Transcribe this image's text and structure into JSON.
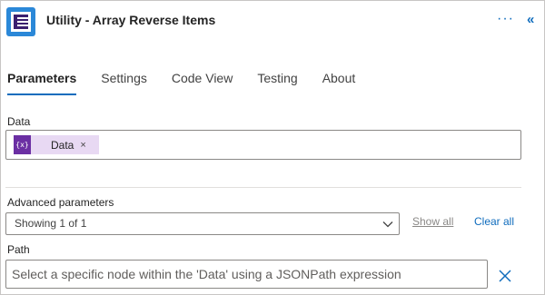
{
  "header": {
    "title": "Utility - Array Reverse Items",
    "more_glyph": "···",
    "collapse_glyph": "«",
    "icons": [
      "app-logo-icon",
      "more-options-icon",
      "collapse-panel-icon"
    ]
  },
  "tabs": [
    {
      "label": "Parameters",
      "active": true
    },
    {
      "label": "Settings",
      "active": false
    },
    {
      "label": "Code View",
      "active": false
    },
    {
      "label": "Testing",
      "active": false
    },
    {
      "label": "About",
      "active": false
    }
  ],
  "data_field": {
    "label": "Data",
    "token": {
      "icon_text": "{x}",
      "label": "Data",
      "close_glyph": "×"
    }
  },
  "advanced": {
    "label": "Advanced parameters",
    "select_value": "Showing 1 of 1",
    "show_all": "Show all",
    "clear_all": "Clear all"
  },
  "path_field": {
    "label": "Path",
    "placeholder": "Select a specific node within the 'Data' using a JSONPath expression"
  },
  "colors": {
    "accent": "#0f6cbd",
    "token_bg": "#e8d9f3",
    "token_icon": "#6b2fa3",
    "app_icon": "#2b88d8"
  }
}
